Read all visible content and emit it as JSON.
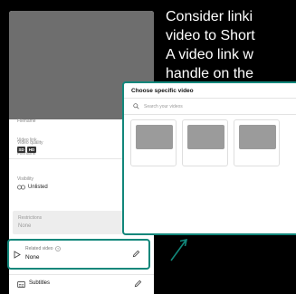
{
  "caption": {
    "line1": "Consider linki",
    "line2": "video to Short",
    "line3": "A video link w",
    "line4": "handle on the"
  },
  "studio_panel": {
    "video_link_label": "Video link",
    "filename_label": "Filename",
    "video_quality_label": "Video quality",
    "quality_badges": [
      "SD",
      "HD"
    ],
    "visibility_label": "Visibility",
    "visibility_value": "Unlisted",
    "restrictions_label": "Restrictions",
    "restrictions_value": "None",
    "related_video_label": "Related video",
    "related_video_value": "None",
    "subtitles_label": "Subtitles"
  },
  "dialog": {
    "title": "Choose specific video",
    "search_placeholder": "Search your videos"
  },
  "colors": {
    "highlight": "#12877b",
    "background": "#000000",
    "thumbnail": "#6e6e6e",
    "card_thumb": "#9b9b9b"
  }
}
